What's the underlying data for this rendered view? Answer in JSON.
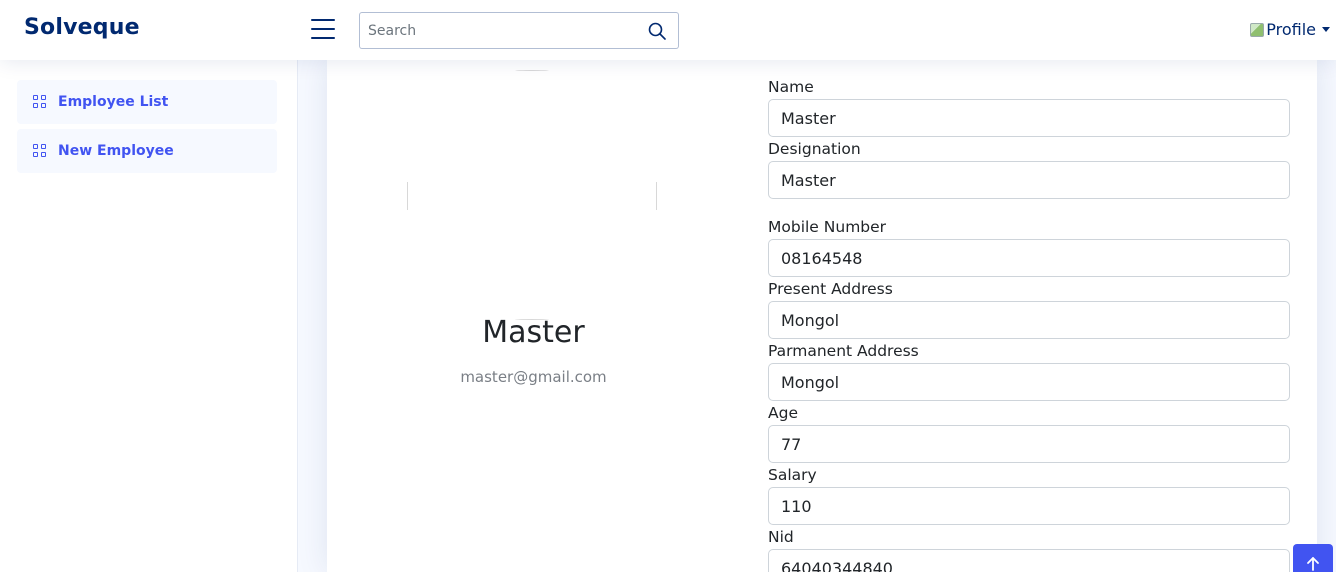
{
  "header": {
    "logo": "Solveque",
    "search": {
      "placeholder": "Search",
      "value": ""
    },
    "profile_label": "Profile"
  },
  "sidebar": {
    "items": [
      {
        "label": "Employee List",
        "icon": "grid-icon"
      },
      {
        "label": "New Employee",
        "icon": "grid-icon"
      }
    ]
  },
  "profile": {
    "name": "Master",
    "email": "master@gmail.com"
  },
  "form": {
    "fields": [
      {
        "label": "Name",
        "value": "Master"
      },
      {
        "label": "Designation",
        "value": "Master"
      },
      {
        "label": "Mobile Number",
        "value": "08164548"
      },
      {
        "label": "Present Address",
        "value": "Mongol"
      },
      {
        "label": "Parmanent Address",
        "value": "Mongol"
      },
      {
        "label": "Age",
        "value": "77"
      },
      {
        "label": "Salary",
        "value": "110"
      },
      {
        "label": "Nid",
        "value": "64040344840"
      }
    ]
  },
  "colors": {
    "brand": "#012970",
    "accent": "#4154f1",
    "page_bg": "#f6f9ff"
  },
  "back_to_top_icon": "arrow-up-icon"
}
